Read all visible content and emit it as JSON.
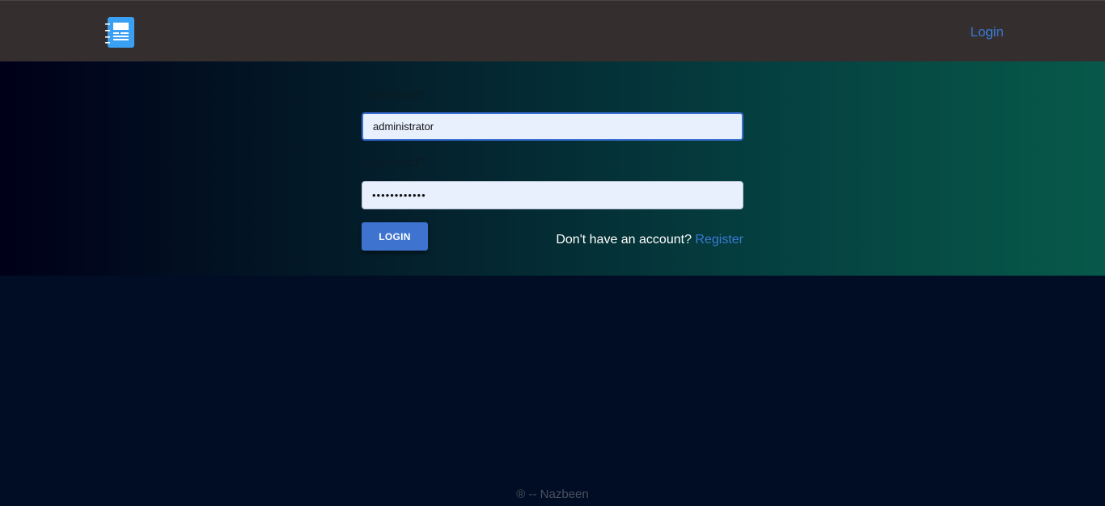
{
  "navbar": {
    "logo_icon": "notebook-icon",
    "login_link": "Login"
  },
  "form": {
    "username_label": "Username*",
    "username_value": "administrator",
    "password_label": "Password*",
    "password_value": "••••••••••••",
    "login_button": "LOGIN",
    "register_prompt": "Don't have an account?",
    "register_link": "Register"
  },
  "footer": {
    "text": "® -- Nazbeen"
  },
  "colors": {
    "navbar_bg": "#352e2e",
    "accent": "#3a7bd5",
    "button_bg": "#3e74d0",
    "page_bg": "#000d24",
    "input_bg": "#e8f0fe"
  }
}
